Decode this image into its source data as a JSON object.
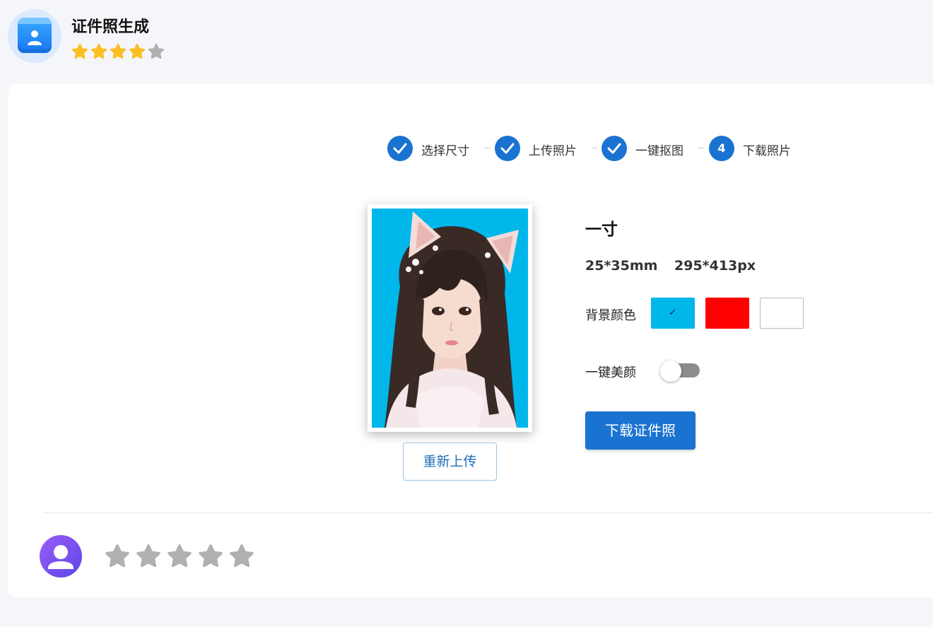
{
  "app": {
    "title": "证件照生成",
    "rating": {
      "value": 4,
      "max": 5
    }
  },
  "steps": [
    {
      "label": "选择尺寸",
      "status": "done",
      "number": "1"
    },
    {
      "label": "上传照片",
      "status": "done",
      "number": "2"
    },
    {
      "label": "一键抠图",
      "status": "done",
      "number": "3"
    },
    {
      "label": "下载照片",
      "status": "current",
      "number": "4"
    }
  ],
  "photo": {
    "background_color": "#00b7ec",
    "reupload_label": "重新上传"
  },
  "details": {
    "size_name": "一寸",
    "size_mm": "25*35mm",
    "size_px": "295*413px",
    "background_label": "背景颜色",
    "background_options": [
      {
        "color": "#00b7ec",
        "selected": true
      },
      {
        "color": "#ff0000",
        "selected": false
      },
      {
        "color": "#ffffff",
        "selected": false
      }
    ],
    "beauty_label": "一键美颜",
    "beauty_enabled": false,
    "download_label": "下载证件照"
  },
  "user_rating": {
    "value": 0,
    "max": 5
  },
  "colors": {
    "accent": "#1a73d1",
    "star_active": "#fbbf24",
    "star_inactive": "#b0b0b0"
  }
}
